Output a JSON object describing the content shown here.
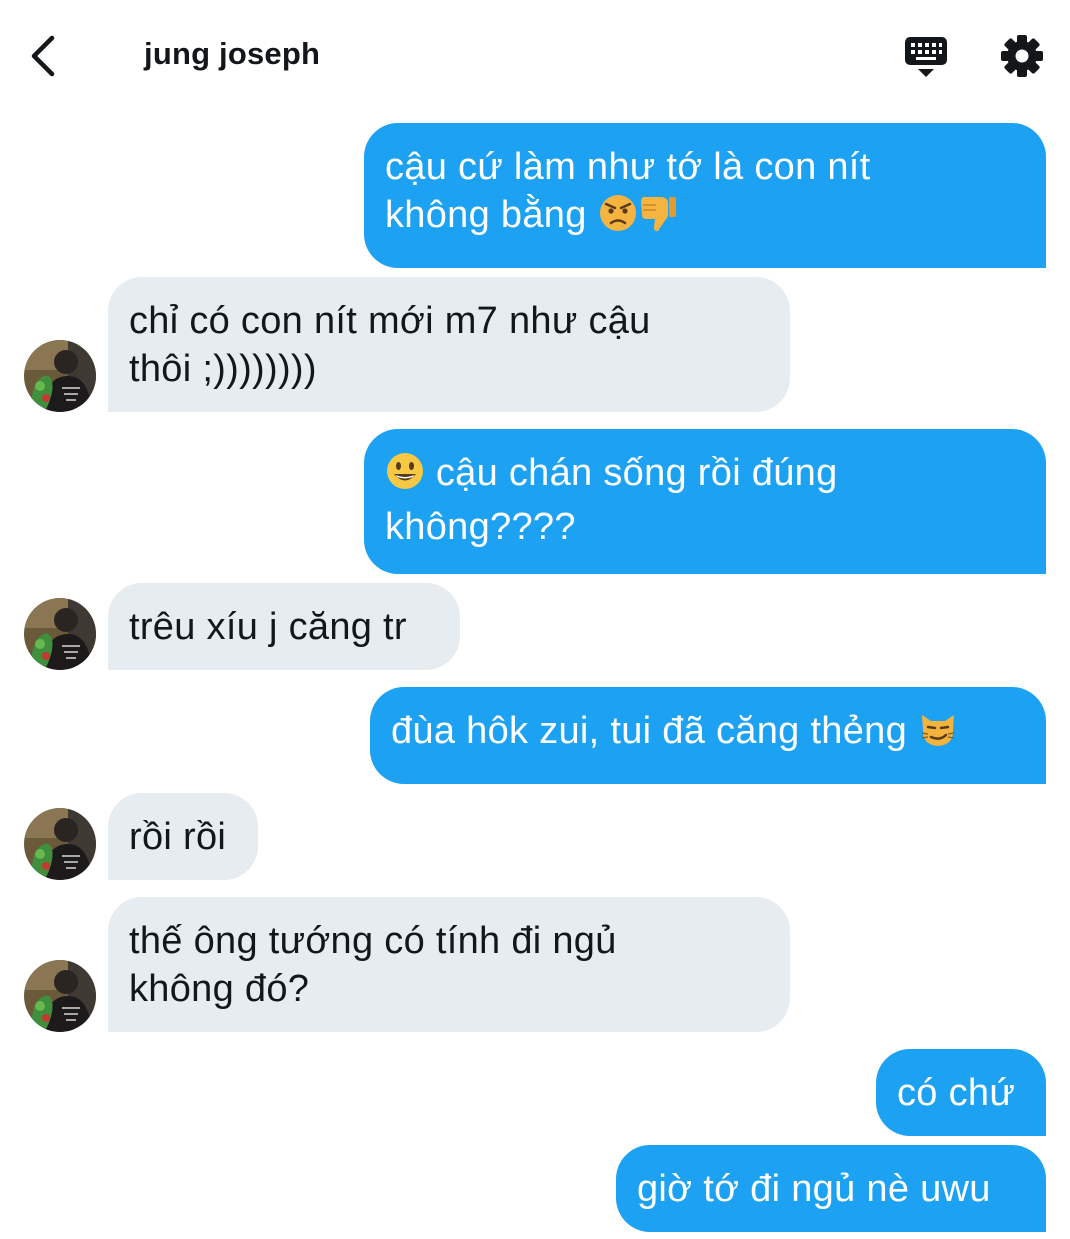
{
  "header": {
    "title": "jung joseph",
    "icons": [
      "back-chevron-icon",
      "keyboard-icon",
      "gear-icon"
    ]
  },
  "messages": [
    {
      "sender": "me",
      "lines": [
        "cậu cứ làm như tớ là con nít",
        "không bằng"
      ],
      "emoji": [
        "angry-face-icon",
        "thumbs-down-icon"
      ]
    },
    {
      "sender": "them",
      "lines": [
        "chỉ có con nít mới m7 như cậu",
        "thôi ;))))))))"
      ]
    },
    {
      "sender": "me",
      "lines": [
        "cậu chán sống rồi đúng",
        "không????"
      ],
      "emoji": [
        "grinning-face-icon"
      ]
    },
    {
      "sender": "them",
      "lines": [
        "trêu xíu j căng tr"
      ]
    },
    {
      "sender": "me",
      "lines": [
        "đùa hôk zui, tui đã căng thẻng"
      ],
      "emoji": [
        "smirking-cat-icon"
      ]
    },
    {
      "sender": "them",
      "lines": [
        "rồi rồi"
      ]
    },
    {
      "sender": "them",
      "lines": [
        "thế ông tướng có tính đi ngủ",
        "không đó?"
      ]
    },
    {
      "sender": "me",
      "lines": [
        "có chứ"
      ]
    },
    {
      "sender": "me",
      "lines": [
        "giờ tớ đi ngủ nè uwu"
      ]
    }
  ],
  "colors": {
    "outgoing_bubble": "#1da1f2",
    "incoming_bubble": "#e6ecf0",
    "text_dark": "#14171a"
  }
}
